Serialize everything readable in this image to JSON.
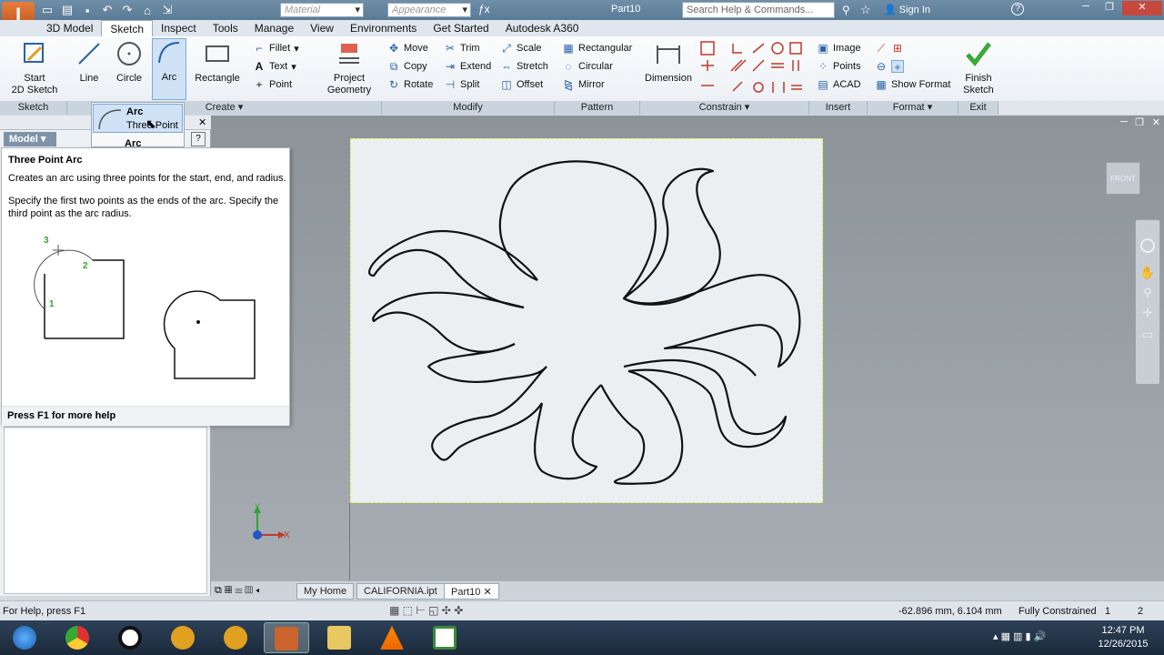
{
  "titlebar": {
    "material_placeholder": "Material",
    "appearance_placeholder": "Appearance",
    "doc_title": "Part10",
    "search_placeholder": "Search Help & Commands...",
    "sign_in": "Sign In",
    "help": "?"
  },
  "menu": [
    "3D Model",
    "Sketch",
    "Inspect",
    "Tools",
    "Manage",
    "View",
    "Environments",
    "Get Started",
    "Autodesk A360"
  ],
  "ribbon": {
    "start_sketch": "Start\n2D Sketch",
    "line": "Line",
    "circle": "Circle",
    "arc": "Arc",
    "rectangle": "Rectangle",
    "fillet": "Fillet",
    "text": "Text",
    "point": "Point",
    "project_geometry": "Project\nGeometry",
    "move": "Move",
    "copy": "Copy",
    "rotate": "Rotate",
    "trim": "Trim",
    "extend": "Extend",
    "split": "Split",
    "scale": "Scale",
    "stretch": "Stretch",
    "offset": "Offset",
    "rectangular": "Rectangular",
    "circular": "Circular",
    "mirror": "Mirror",
    "dimension": "Dimension",
    "image": "Image",
    "points": "Points",
    "acad": "ACAD",
    "show_format": "Show Format",
    "finish_sketch": "Finish\nSketch",
    "groups": {
      "sketch": "Sketch",
      "create": "Create",
      "modify": "Modify",
      "pattern": "Pattern",
      "constrain": "Constrain",
      "insert": "Insert",
      "format": "Format",
      "exit": "Exit"
    }
  },
  "arc_dropdown": {
    "item1_title": "Arc",
    "item1_sub": "Three Point",
    "item2_title": "Arc"
  },
  "model_panel": {
    "title": "Model"
  },
  "tooltip": {
    "title": "Three Point Arc",
    "description": "Creates an arc using three points for the start, end, and radius.",
    "help": "Specify the first two points as the ends of the arc. Specify the third point as the arc radius.",
    "num1": "1",
    "num2": "2",
    "num3": "3",
    "footer": "Press F1 for more help"
  },
  "viewcube": "FRONT",
  "triad": {
    "x": "X",
    "y": "Y"
  },
  "doc_tabs": [
    "My Home",
    "CALIFORNIA.ipt",
    "Part10"
  ],
  "status": {
    "help": "For Help, press F1",
    "coords": "-62.896 mm, 6.104 mm",
    "constraint": "Fully Constrained",
    "count1": "1",
    "count2": "2"
  },
  "clock": {
    "time": "12:47 PM",
    "date": "12/26/2015"
  },
  "colors": {
    "accent": "#1e64b4",
    "titlebar": "#6f8ea8",
    "ribbon_group": "#c9d4df",
    "viewport": "#9ba1a7"
  }
}
